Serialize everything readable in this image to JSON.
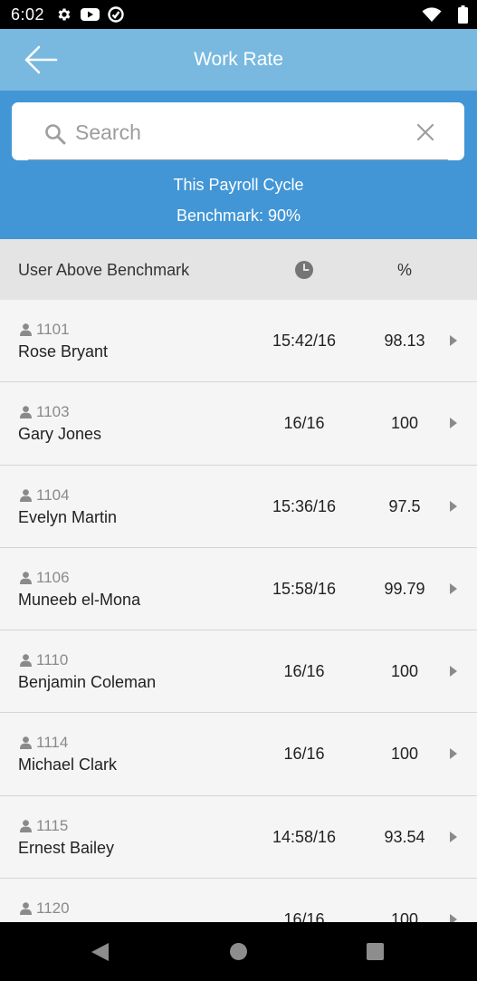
{
  "status_bar": {
    "time": "6:02",
    "left_icons": [
      "settings-gear-icon",
      "youtube-icon",
      "no-sync-icon"
    ],
    "right_icons": [
      "wifi-icon",
      "battery-icon"
    ]
  },
  "header": {
    "title": "Work Rate",
    "back_icon": "arrow-left-icon"
  },
  "search": {
    "placeholder": "Search",
    "value": "",
    "icon": "search-icon",
    "clear_icon": "close-icon"
  },
  "summary": {
    "cycle": "This Payroll Cycle",
    "benchmark": "Benchmark: 90%"
  },
  "table": {
    "columns": {
      "user": "User Above Benchmark",
      "time_icon": "clock-icon",
      "percent": "%"
    },
    "rows": [
      {
        "id": "1101",
        "name": "Rose Bryant",
        "time": "15:42/16",
        "percent": "98.13"
      },
      {
        "id": "1103",
        "name": "Gary Jones",
        "time": "16/16",
        "percent": "100"
      },
      {
        "id": "1104",
        "name": "Evelyn Martin",
        "time": "15:36/16",
        "percent": "97.5"
      },
      {
        "id": "1106",
        "name": "Muneeb el-Mona",
        "time": "15:58/16",
        "percent": "99.79"
      },
      {
        "id": "1110",
        "name": "Benjamin Coleman",
        "time": "16/16",
        "percent": "100"
      },
      {
        "id": "1114",
        "name": "Michael Clark",
        "time": "16/16",
        "percent": "100"
      },
      {
        "id": "1115",
        "name": "Ernest Bailey",
        "time": "14:58/16",
        "percent": "93.54"
      },
      {
        "id": "1120",
        "name": "",
        "time": "16/16",
        "percent": "100"
      }
    ]
  },
  "colors": {
    "header": "#79b9e0",
    "panel": "#4296d6",
    "table_header": "#e4e4e4",
    "row_background": "#f5f5f5"
  }
}
